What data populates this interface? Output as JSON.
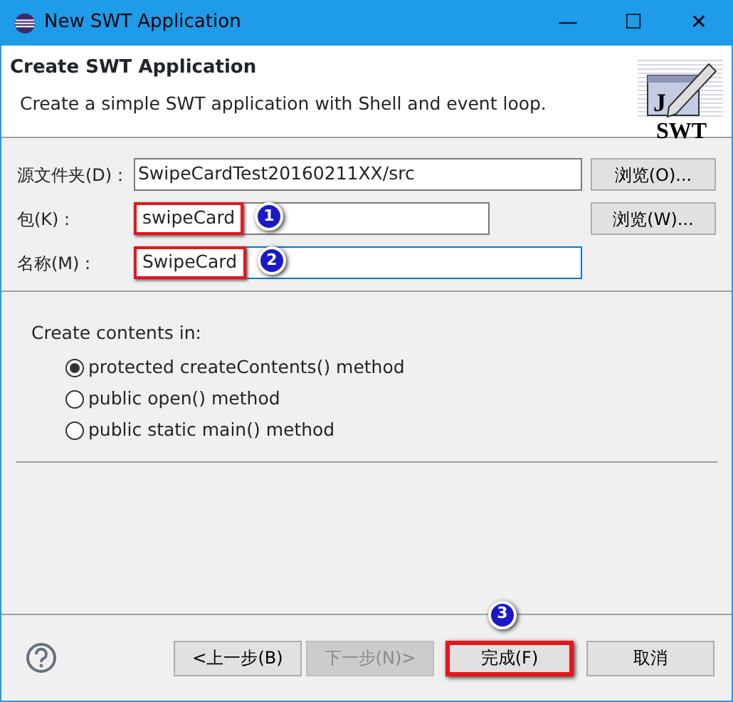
{
  "window": {
    "title": "New SWT Application",
    "controls": [
      "—",
      "☐",
      "✕"
    ]
  },
  "header": {
    "title": "Create SWT Application",
    "description": "Create a simple SWT application with Shell and event loop.",
    "logo_letter": "J",
    "logo_text": "SWT"
  },
  "fields": [
    {
      "label": "源文件夹(D)：",
      "value": "SwipeCardTest20160211XX/src",
      "button": "浏览(O)...",
      "focused": false,
      "highlighted": false
    },
    {
      "label": "包(K)：",
      "value": "swipeCard",
      "button": "浏览(W)...",
      "focused": false,
      "highlighted": true,
      "annotation": "1"
    },
    {
      "label": "名称(M)：",
      "value": "SwipeCard",
      "focused": true,
      "highlighted": true,
      "annotation": "2"
    }
  ],
  "contents": {
    "label": "Create contents in:",
    "options": [
      {
        "label": "protected createContents() method",
        "selected": true
      },
      {
        "label": "public open() method",
        "selected": false
      },
      {
        "label": "public static main() method",
        "selected": false
      }
    ]
  },
  "buttons": [
    {
      "label": "<上一步(B)",
      "disabled": false,
      "highlighted": false
    },
    {
      "label": "下一步(N)>",
      "disabled": true,
      "highlighted": false
    },
    {
      "label": "完成(F)",
      "disabled": false,
      "highlighted": true,
      "annotation": "3"
    },
    {
      "label": "取消",
      "disabled": false,
      "highlighted": false
    }
  ]
}
